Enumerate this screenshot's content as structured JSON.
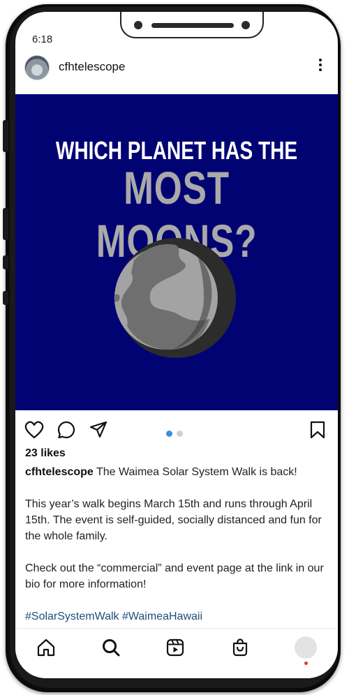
{
  "status_bar": {
    "time": "6:18"
  },
  "post": {
    "username": "cfhtelescope",
    "image": {
      "title_line1": "WHICH PLANET HAS THE",
      "title_line2": "MOST MOONS?",
      "background_color": "#020373",
      "planet_icon": "planet-illustration"
    },
    "carousel": {
      "total": 2,
      "active": 1,
      "active_color": "#3a8fd6",
      "inactive_color": "#d0d0d0"
    },
    "likes": "23 likes",
    "caption": {
      "username": "cfhtelescope",
      "intro": "The Waimea Solar System Walk is back!",
      "paragraph1": "This year’s walk begins March 15th and runs through April 15th.  The event is self-guided, socially distanced and fun for the whole family.",
      "paragraph2": "Check out the “commercial” and event page at the link in our bio for more information!",
      "hashtags": "#SolarSystemWalk #WaimeaHawaii"
    }
  },
  "actions": [
    "heart-icon",
    "comment-icon",
    "share-icon",
    "bookmark-icon"
  ],
  "bottom_nav": [
    "home-icon",
    "search-icon",
    "reels-icon",
    "shop-icon",
    "profile-avatar"
  ],
  "colors": {
    "hashtag": "#1e4e7a",
    "notification_dot": "#e53935"
  }
}
